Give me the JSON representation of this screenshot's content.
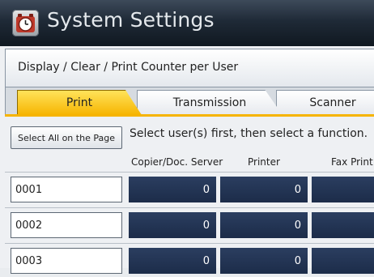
{
  "window": {
    "title": "System Settings",
    "icon": "settings-clock-icon"
  },
  "breadcrumb": "Display / Clear / Print Counter per User",
  "tabs": [
    {
      "label": "Print",
      "active": true
    },
    {
      "label": "Transmission",
      "active": false
    },
    {
      "label": "Scanner",
      "active": false
    }
  ],
  "select_all_label": "Select All on the Page",
  "instruction": "Select user(s) first, then select a function.",
  "columns": [
    "Copier/Doc. Server",
    "Printer",
    "Fax Print"
  ],
  "rows": [
    {
      "user": "0001",
      "values": [
        "0",
        "0",
        ""
      ]
    },
    {
      "user": "0002",
      "values": [
        "0",
        "0",
        ""
      ]
    },
    {
      "user": "0003",
      "values": [
        "0",
        "0",
        ""
      ]
    }
  ],
  "colors": {
    "active_tab": "#f6b400",
    "counter_bg": "#1f2f4e",
    "titlebar": "#1f2a37"
  }
}
